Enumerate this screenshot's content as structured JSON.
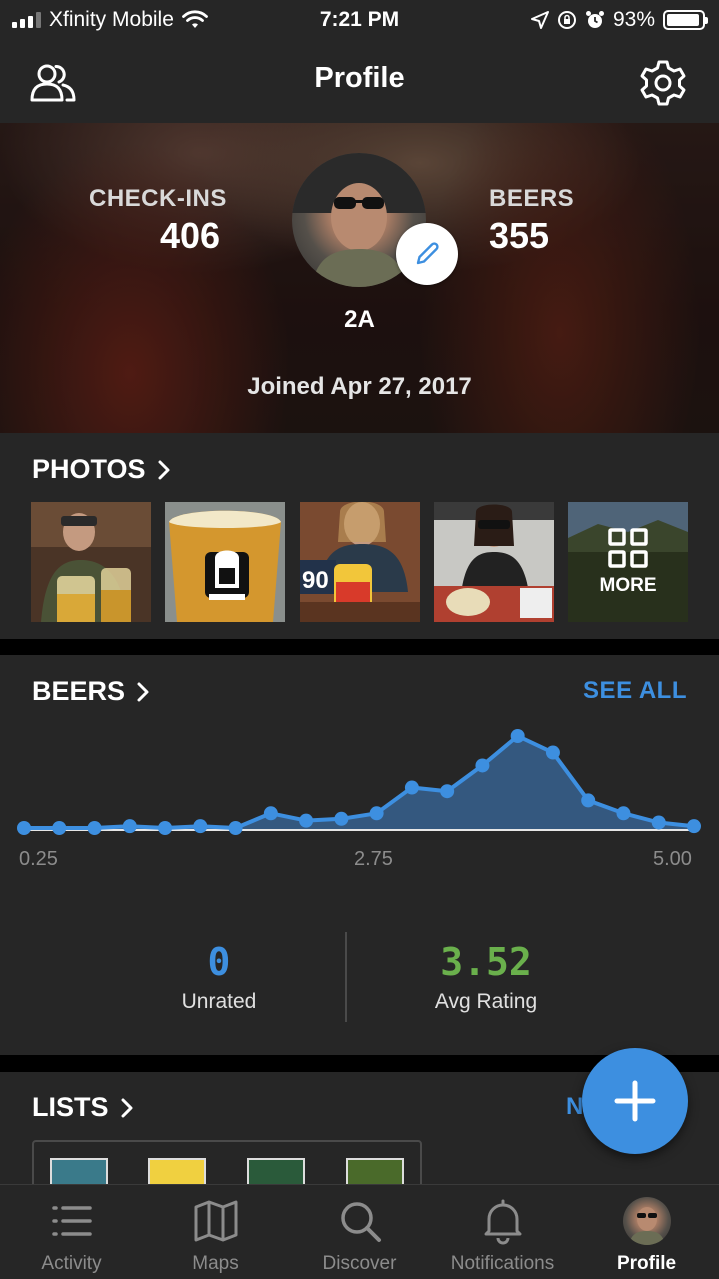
{
  "status_bar": {
    "carrier": "Xfinity Mobile",
    "time": "7:21 PM",
    "battery": "93%",
    "battery_level": 0.93
  },
  "nav": {
    "title": "Profile",
    "left_icon": "friends-icon",
    "right_icon": "gear-icon"
  },
  "profile": {
    "checkins_label": "CHECK-INS",
    "checkins_value": "406",
    "beers_label": "BEERS",
    "beers_value": "355",
    "username": "2A",
    "joined": "Joined Apr 27, 2017"
  },
  "photos": {
    "title": "PHOTOS",
    "more_label": "MORE",
    "items": [
      "man-with-beer-photo",
      "beer-glass-photo",
      "woman-with-can-photo",
      "woman-at-table-photo"
    ]
  },
  "beers_section": {
    "title": "BEERS",
    "see_all": "SEE ALL",
    "unrated_value": "0",
    "unrated_label": "Unrated",
    "avg_value": "3.52",
    "avg_label": "Avg Rating",
    "avg_color": "#6ab04c",
    "unrated_color": "#3d8fe0"
  },
  "chart_data": {
    "type": "area",
    "x_tick_labels": [
      "0.25",
      "2.75",
      "5.00"
    ],
    "x": [
      0.25,
      0.5,
      0.75,
      1.0,
      1.25,
      1.5,
      1.75,
      2.0,
      2.25,
      2.5,
      2.75,
      3.0,
      3.25,
      3.5,
      3.75,
      4.0,
      4.25,
      4.5,
      4.75,
      5.0
    ],
    "values": [
      0,
      0,
      0,
      1,
      0,
      1,
      0,
      8,
      4,
      5,
      8,
      22,
      20,
      34,
      50,
      41,
      15,
      8,
      3,
      1
    ],
    "color": "#3d8fe0"
  },
  "lists": {
    "title": "LISTS",
    "new_label": "N"
  },
  "tabs": [
    {
      "label": "Activity",
      "icon": "activity-list-icon"
    },
    {
      "label": "Maps",
      "icon": "map-icon"
    },
    {
      "label": "Discover",
      "icon": "search-icon"
    },
    {
      "label": "Notifications",
      "icon": "bell-icon"
    },
    {
      "label": "Profile",
      "icon": "profile-avatar"
    }
  ]
}
